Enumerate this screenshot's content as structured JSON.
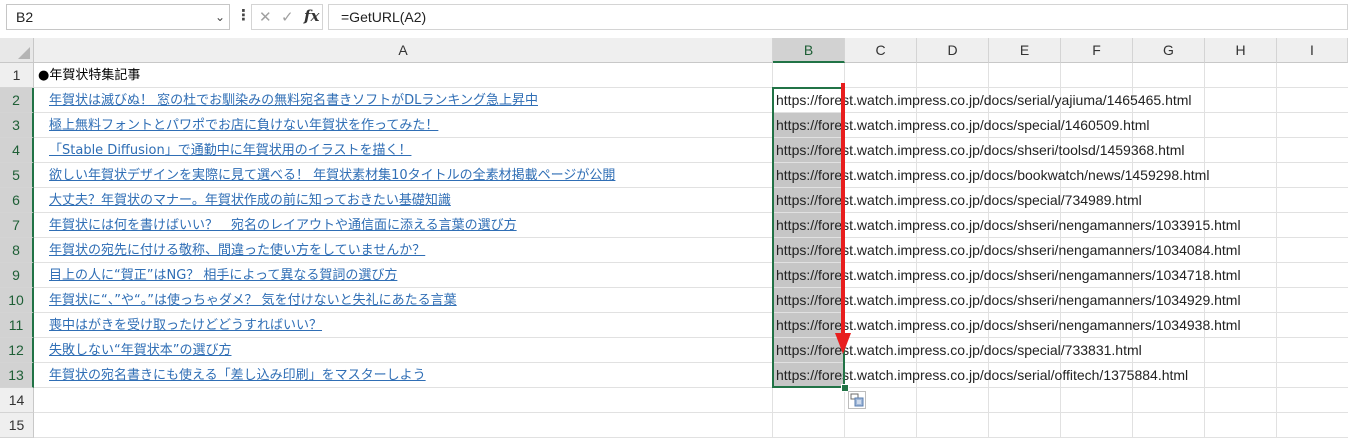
{
  "namebox": {
    "value": "B2",
    "dropdown_icon": "chevron-down-icon"
  },
  "formula_bar": {
    "more_icon": "vertical-ellipsis-icon",
    "cancel_icon": "cross-icon",
    "enter_icon": "check-icon",
    "fx_label": "fx",
    "formula": "=GetURL(A2)"
  },
  "columns": [
    "A",
    "B",
    "C",
    "D",
    "E",
    "F",
    "G",
    "H",
    "I"
  ],
  "rows": [
    "1",
    "2",
    "3",
    "4",
    "5",
    "6",
    "7",
    "8",
    "9",
    "10",
    "11",
    "12",
    "13",
    "14",
    "15"
  ],
  "selection": {
    "range": "B2:B13",
    "active": "B2",
    "accent": "#217346",
    "link_color": "#2f6eb5",
    "arrow_color": "#e81e1e"
  },
  "cells": {
    "a1": "●年賀状特集記事",
    "col_a": [
      "年賀状は滅びぬ！ 窓の杜でお馴染みの無料宛名書きソフトがDLランキング急上昇中",
      "極上無料フォントとパワポでお店に負けない年賀状を作ってみた！",
      "「Stable Diffusion」で通勤中に年賀状用のイラストを描く！",
      "欲しい年賀状デザインを実際に見て選べる！ 年賀状素材集10タイトルの全素材掲載ページが公開",
      "大丈夫？年賀状のマナー。年賀状作成の前に知っておきたい基礎知識",
      "年賀状には何を書けばいい？　宛名のレイアウトや通信面に添える言葉の選び方",
      "年賀状の宛先に付ける敬称、間違った使い方をしていませんか？",
      "目上の人に“賀正”はNG？ 相手によって異なる賀詞の選び方",
      "年賀状に“、”や“。”は使っちゃダメ？ 気を付けないと失礼にあたる言葉",
      "喪中はがきを受け取ったけどどうすればいい？",
      "失敗しない“年賀状本”の選び方",
      "年賀状の宛名書きにも使える「差し込み印刷」をマスターしよう"
    ],
    "col_b": [
      "https://forest.watch.impress.co.jp/docs/serial/yajiuma/1465465.html",
      "https://forest.watch.impress.co.jp/docs/special/1460509.html",
      "https://forest.watch.impress.co.jp/docs/shseri/toolsd/1459368.html",
      "https://forest.watch.impress.co.jp/docs/bookwatch/news/1459298.html",
      "https://forest.watch.impress.co.jp/docs/special/734989.html",
      "https://forest.watch.impress.co.jp/docs/shseri/nengamanners/1033915.html",
      "https://forest.watch.impress.co.jp/docs/shseri/nengamanners/1034084.html",
      "https://forest.watch.impress.co.jp/docs/shseri/nengamanners/1034718.html",
      "https://forest.watch.impress.co.jp/docs/shseri/nengamanners/1034929.html",
      "https://forest.watch.impress.co.jp/docs/shseri/nengamanners/1034938.html",
      "https://forest.watch.impress.co.jp/docs/special/733831.html",
      "https://forest.watch.impress.co.jp/docs/serial/offitech/1375884.html"
    ]
  },
  "paste_options_icon": "paste-options-icon"
}
